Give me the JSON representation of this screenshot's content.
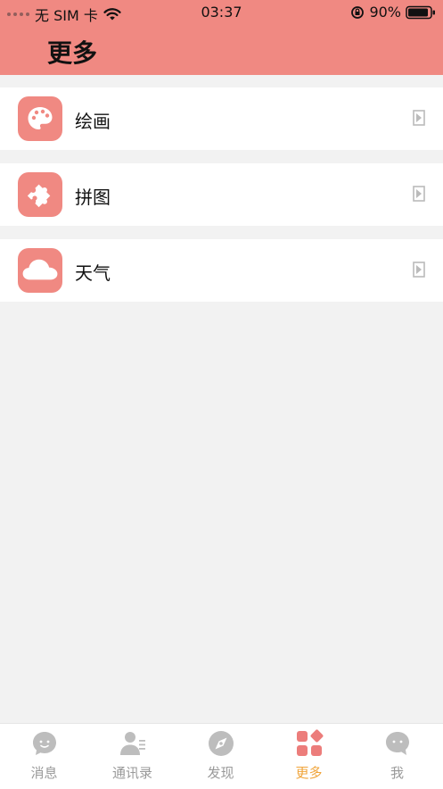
{
  "status_bar": {
    "carrier": "无 SIM 卡",
    "time": "03:37",
    "battery": "90%"
  },
  "header": {
    "title": "更多"
  },
  "list": {
    "items": [
      {
        "label": "绘画",
        "icon": "palette-icon"
      },
      {
        "label": "拼图",
        "icon": "puzzle-icon"
      },
      {
        "label": "天气",
        "icon": "cloud-icon"
      }
    ]
  },
  "tabs": [
    {
      "label": "消息",
      "icon": "message-icon",
      "active": false
    },
    {
      "label": "通讯录",
      "icon": "contacts-icon",
      "active": false
    },
    {
      "label": "发现",
      "icon": "compass-icon",
      "active": false
    },
    {
      "label": "更多",
      "icon": "grid-icon",
      "active": true
    },
    {
      "label": "我",
      "icon": "profile-icon",
      "active": false
    }
  ],
  "colors": {
    "brand": "#f08982",
    "active_tab": "#f0a43a",
    "inactive_tab": "#999999",
    "background": "#f2f2f2"
  }
}
